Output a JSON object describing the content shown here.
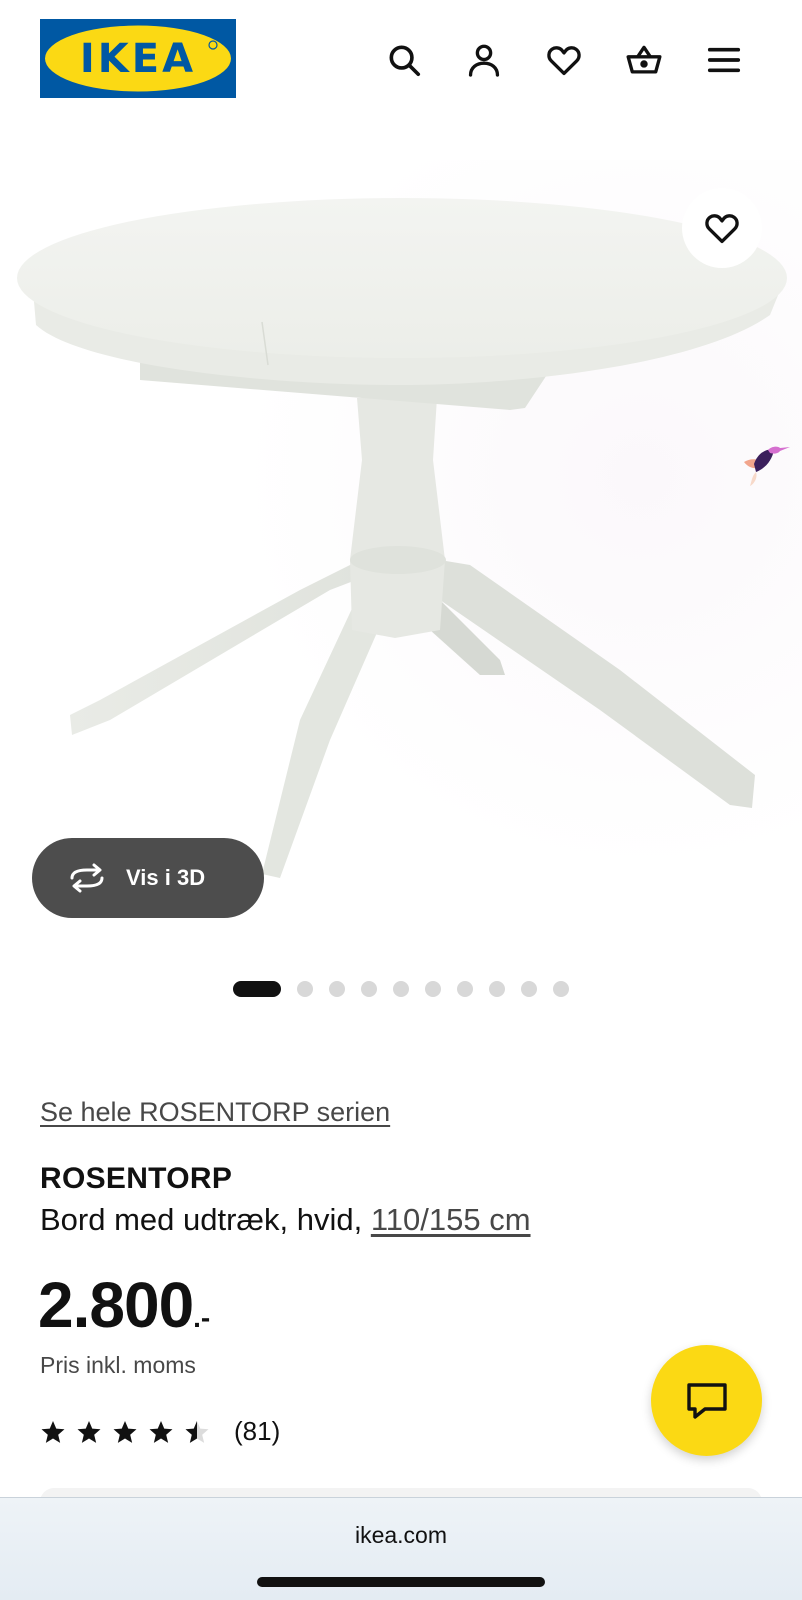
{
  "header": {
    "logo_text": "IKEA",
    "icons": [
      "search-icon",
      "account-icon",
      "heart-icon",
      "basket-icon",
      "menu-icon"
    ]
  },
  "gallery": {
    "view_3d_label": "Vis i 3D",
    "image_count": 10,
    "active_index": 0
  },
  "product": {
    "series_link": "Se hele ROSENTORP serien",
    "name": "ROSENTORP",
    "description": "Bord med udtræk, hvid, ",
    "dimensions": "110/155 cm",
    "price_integer": "2.800",
    "price_suffix": ".-",
    "vat_note": "Pris inkl. moms",
    "rating": 4.5,
    "review_count": "(81)"
  },
  "browser": {
    "url": "ikea.com"
  },
  "colors": {
    "brand_blue": "#0058a3",
    "brand_yellow": "#fbd914",
    "button_dark": "#4d4d4d"
  }
}
